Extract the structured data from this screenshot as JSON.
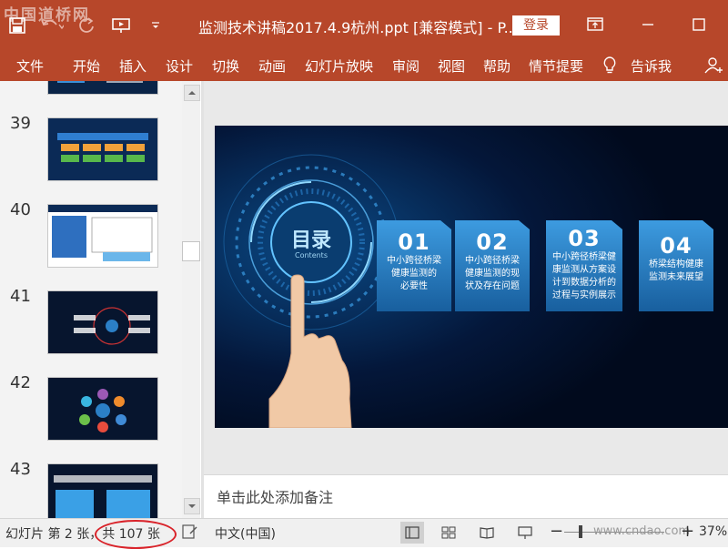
{
  "app": {
    "watermark": "中国道桥网",
    "document_title": "监测技术讲稿2017.4.9杭州.ppt [兼容模式] - P...",
    "login_label": "登录"
  },
  "ribbon": {
    "tabs": [
      "文件",
      "开始",
      "插入",
      "设计",
      "切换",
      "动画",
      "幻灯片放映",
      "审阅",
      "视图",
      "帮助",
      "情节提要",
      "告诉我"
    ]
  },
  "thumbnails": [
    {
      "number": ""
    },
    {
      "number": "39"
    },
    {
      "number": "40"
    },
    {
      "number": "41"
    },
    {
      "number": "42"
    },
    {
      "number": "43"
    }
  ],
  "slide": {
    "catalog_title": "目录",
    "catalog_subtitle": "Contents",
    "items": [
      {
        "num": "01",
        "text_line1": "中小跨径桥梁",
        "text_line2": "健康监测的",
        "text_line3": "必要性",
        "text_line4": ""
      },
      {
        "num": "02",
        "text_line1": "中小跨径桥梁",
        "text_line2": "健康监测的现",
        "text_line3": "状及存在问题",
        "text_line4": ""
      },
      {
        "num": "03",
        "text_line1": "中小跨径桥梁健",
        "text_line2": "康监测从方案设",
        "text_line3": "计到数据分析的",
        "text_line4": "过程与实例展示"
      },
      {
        "num": "04",
        "text_line1": "桥梁结构健康",
        "text_line2": "监测未来展望",
        "text_line3": "",
        "text_line4": ""
      }
    ]
  },
  "notes": {
    "placeholder": "单击此处添加备注"
  },
  "statusbar": {
    "slide_info": "幻灯片 第 2 张，共 107 张",
    "language": "中文(中国)",
    "watermark_url": "www.cndao.com",
    "zoom": "37%"
  },
  "colors": {
    "accent": "#b7472a",
    "slide_bg": "#020f26",
    "tile_blue": "#2b7fc6",
    "annotation_red": "#d9232a"
  }
}
